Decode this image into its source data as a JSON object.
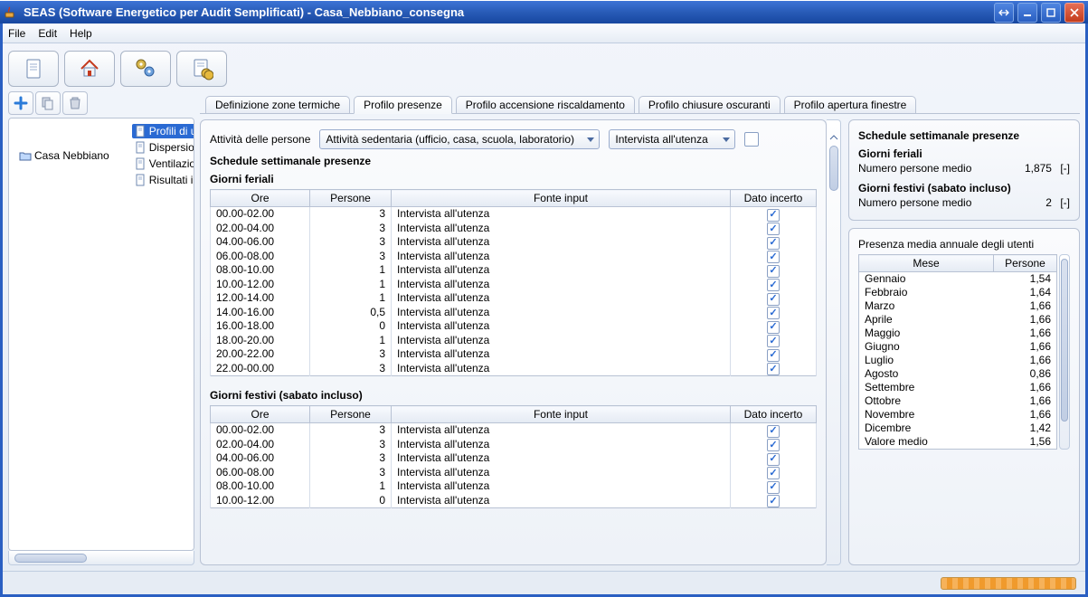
{
  "window": {
    "title": "SEAS (Software Energetico per Audit Semplificati) - Casa_Nebbiano_consegna"
  },
  "menu": {
    "items": [
      "File",
      "Edit",
      "Help"
    ]
  },
  "toolbar_icons": [
    "doc-icon",
    "home-icon",
    "gears-icon",
    "table-money-icon"
  ],
  "tree": {
    "root_label": "Casa Nebbiano",
    "children": [
      {
        "label": "Profili di utilizzo",
        "selected": true
      },
      {
        "label": "Dispersioni per trasmissione"
      },
      {
        "label": "Ventilazioni e apporti interni"
      },
      {
        "label": "Risultati involucro"
      }
    ]
  },
  "tabs": [
    {
      "label": "Definizione zone termiche"
    },
    {
      "label": "Profilo presenze",
      "active": true
    },
    {
      "label": "Profilo accensione riscaldamento"
    },
    {
      "label": "Profilo chiusure oscuranti"
    },
    {
      "label": "Profilo apertura finestre"
    }
  ],
  "activity": {
    "label": "Attività delle persone",
    "combo1": "Attività sedentaria (ufficio, casa, scuola, laboratorio)",
    "combo2": "Intervista all'utenza"
  },
  "schedule": {
    "title": "Schedule settimanale presenze",
    "columns": {
      "ore": "Ore",
      "persone": "Persone",
      "fonte": "Fonte input",
      "incerto": "Dato incerto"
    },
    "feriali": {
      "title": "Giorni feriali",
      "rows": [
        {
          "ore": "00.00-02.00",
          "persone": "3",
          "fonte": "Intervista all'utenza",
          "incerto": true
        },
        {
          "ore": "02.00-04.00",
          "persone": "3",
          "fonte": "Intervista all'utenza",
          "incerto": true
        },
        {
          "ore": "04.00-06.00",
          "persone": "3",
          "fonte": "Intervista all'utenza",
          "incerto": true
        },
        {
          "ore": "06.00-08.00",
          "persone": "3",
          "fonte": "Intervista all'utenza",
          "incerto": true
        },
        {
          "ore": "08.00-10.00",
          "persone": "1",
          "fonte": "Intervista all'utenza",
          "incerto": true
        },
        {
          "ore": "10.00-12.00",
          "persone": "1",
          "fonte": "Intervista all'utenza",
          "incerto": true
        },
        {
          "ore": "12.00-14.00",
          "persone": "1",
          "fonte": "Intervista all'utenza",
          "incerto": true
        },
        {
          "ore": "14.00-16.00",
          "persone": "0,5",
          "fonte": "Intervista all'utenza",
          "incerto": true
        },
        {
          "ore": "16.00-18.00",
          "persone": "0",
          "fonte": "Intervista all'utenza",
          "incerto": true
        },
        {
          "ore": "18.00-20.00",
          "persone": "1",
          "fonte": "Intervista all'utenza",
          "incerto": true
        },
        {
          "ore": "20.00-22.00",
          "persone": "3",
          "fonte": "Intervista all'utenza",
          "incerto": true
        },
        {
          "ore": "22.00-00.00",
          "persone": "3",
          "fonte": "Intervista all'utenza",
          "incerto": true
        }
      ]
    },
    "festivi": {
      "title": "Giorni festivi (sabato incluso)",
      "rows": [
        {
          "ore": "00.00-02.00",
          "persone": "3",
          "fonte": "Intervista all'utenza",
          "incerto": true
        },
        {
          "ore": "02.00-04.00",
          "persone": "3",
          "fonte": "Intervista all'utenza",
          "incerto": true
        },
        {
          "ore": "04.00-06.00",
          "persone": "3",
          "fonte": "Intervista all'utenza",
          "incerto": true
        },
        {
          "ore": "06.00-08.00",
          "persone": "3",
          "fonte": "Intervista all'utenza",
          "incerto": true
        },
        {
          "ore": "08.00-10.00",
          "persone": "1",
          "fonte": "Intervista all'utenza",
          "incerto": true
        },
        {
          "ore": "10.00-12.00",
          "persone": "0",
          "fonte": "Intervista all'utenza",
          "incerto": true
        }
      ]
    }
  },
  "summary": {
    "title": "Schedule settimanale presenze",
    "feriali_title": "Giorni feriali",
    "feriali_label": "Numero persone medio",
    "feriali_value": "1,875",
    "unit": "[-]",
    "festivi_title": "Giorni festivi (sabato incluso)",
    "festivi_label": "Numero persone medio",
    "festivi_value": "2"
  },
  "annual": {
    "title": "Presenza media annuale degli utenti",
    "columns": {
      "mese": "Mese",
      "persone": "Persone"
    },
    "rows": [
      {
        "mese": "Gennaio",
        "persone": "1,54"
      },
      {
        "mese": "Febbraio",
        "persone": "1,64"
      },
      {
        "mese": "Marzo",
        "persone": "1,66"
      },
      {
        "mese": "Aprile",
        "persone": "1,66"
      },
      {
        "mese": "Maggio",
        "persone": "1,66"
      },
      {
        "mese": "Giugno",
        "persone": "1,66"
      },
      {
        "mese": "Luglio",
        "persone": "1,66"
      },
      {
        "mese": "Agosto",
        "persone": "0,86"
      },
      {
        "mese": "Settembre",
        "persone": "1,66"
      },
      {
        "mese": "Ottobre",
        "persone": "1,66"
      },
      {
        "mese": "Novembre",
        "persone": "1,66"
      },
      {
        "mese": "Dicembre",
        "persone": "1,42"
      },
      {
        "mese": "Valore medio",
        "persone": "1,56"
      }
    ]
  }
}
